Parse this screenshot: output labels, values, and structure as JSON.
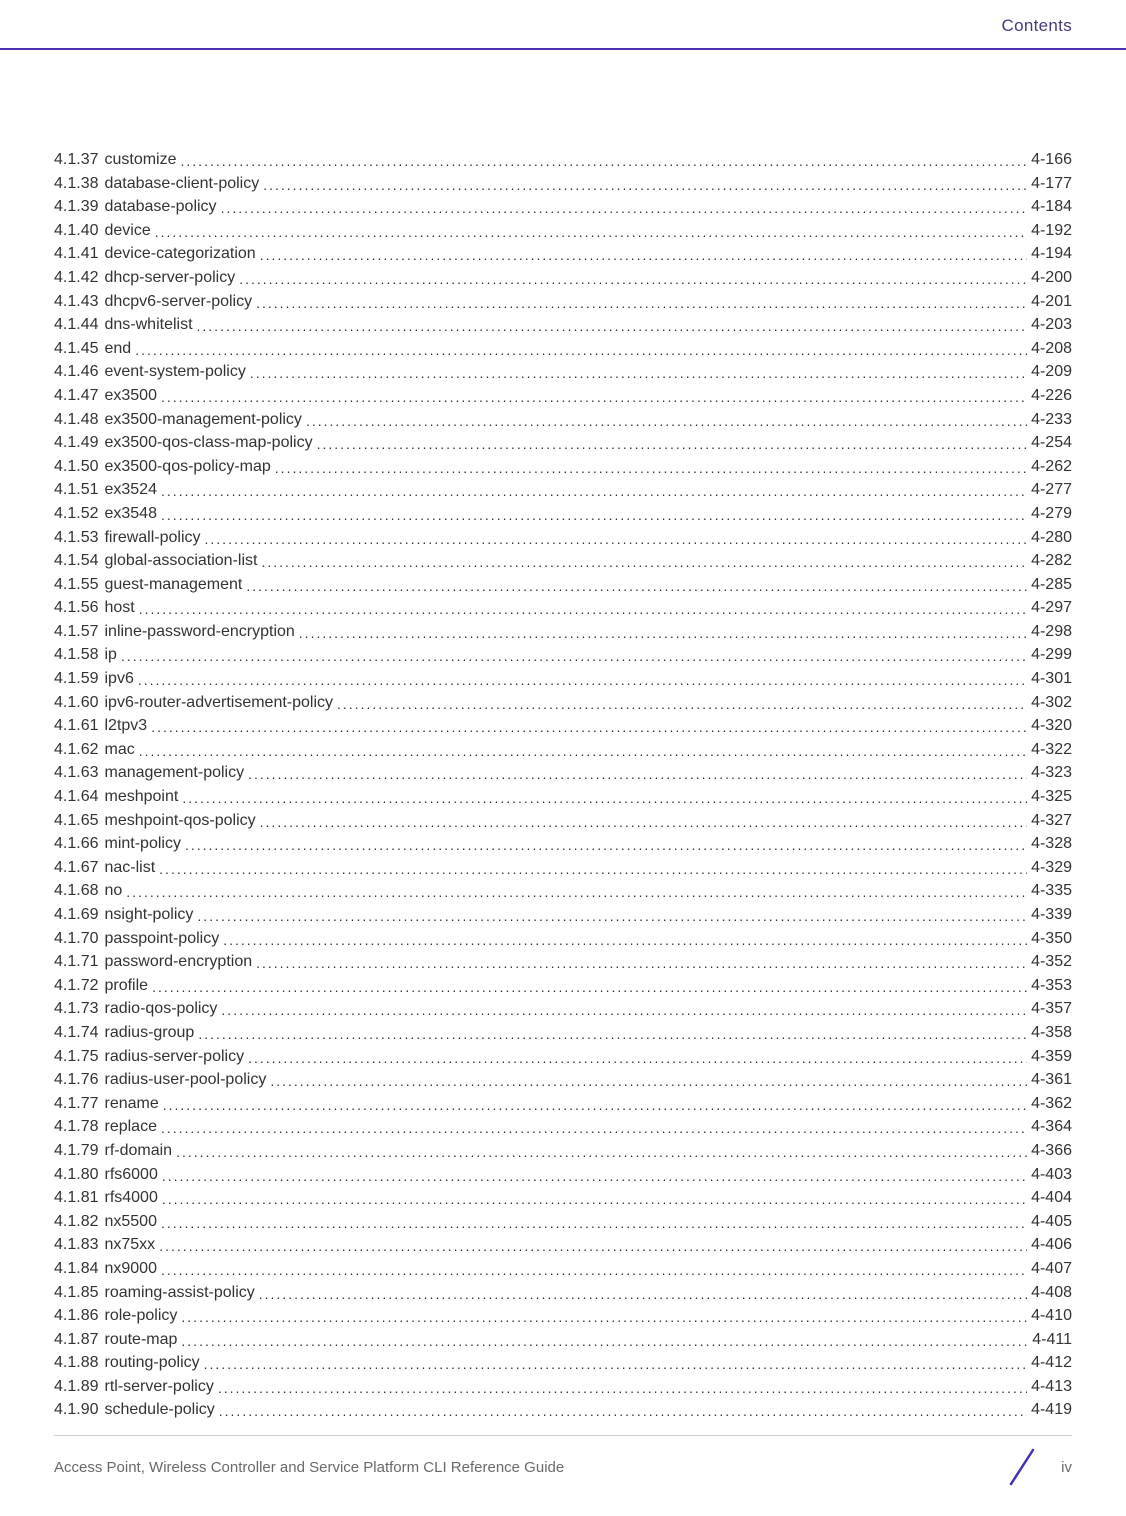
{
  "header": {
    "title": "Contents"
  },
  "toc": {
    "entries": [
      {
        "num": "4.1.37",
        "title": "customize",
        "page": "4-166"
      },
      {
        "num": "4.1.38",
        "title": "database-client-policy",
        "page": "4-177"
      },
      {
        "num": "4.1.39",
        "title": "database-policy",
        "page": "4-184"
      },
      {
        "num": "4.1.40",
        "title": "device",
        "page": "4-192"
      },
      {
        "num": "4.1.41",
        "title": "device-categorization",
        "page": "4-194"
      },
      {
        "num": "4.1.42",
        "title": "dhcp-server-policy",
        "page": "4-200"
      },
      {
        "num": "4.1.43",
        "title": "dhcpv6-server-policy",
        "page": "4-201"
      },
      {
        "num": "4.1.44",
        "title": "dns-whitelist",
        "page": "4-203"
      },
      {
        "num": "4.1.45",
        "title": "end",
        "page": "4-208"
      },
      {
        "num": "4.1.46",
        "title": "event-system-policy",
        "page": "4-209"
      },
      {
        "num": "4.1.47",
        "title": "ex3500",
        "page": "4-226"
      },
      {
        "num": "4.1.48",
        "title": "ex3500-management-policy",
        "page": "4-233"
      },
      {
        "num": "4.1.49",
        "title": "ex3500-qos-class-map-policy",
        "page": "4-254"
      },
      {
        "num": "4.1.50",
        "title": "ex3500-qos-policy-map",
        "page": "4-262"
      },
      {
        "num": "4.1.51",
        "title": "ex3524",
        "page": "4-277"
      },
      {
        "num": "4.1.52",
        "title": "ex3548",
        "page": "4-279"
      },
      {
        "num": "4.1.53",
        "title": "firewall-policy",
        "page": "4-280"
      },
      {
        "num": "4.1.54",
        "title": "global-association-list",
        "page": "4-282"
      },
      {
        "num": "4.1.55",
        "title": "guest-management",
        "page": "4-285"
      },
      {
        "num": "4.1.56",
        "title": "host",
        "page": "4-297"
      },
      {
        "num": "4.1.57",
        "title": "inline-password-encryption",
        "page": "4-298"
      },
      {
        "num": "4.1.58",
        "title": "ip",
        "page": "4-299"
      },
      {
        "num": "4.1.59",
        "title": "ipv6",
        "page": "4-301"
      },
      {
        "num": "4.1.60",
        "title": "ipv6-router-advertisement-policy",
        "page": "4-302"
      },
      {
        "num": "4.1.61",
        "title": "l2tpv3",
        "page": "4-320"
      },
      {
        "num": "4.1.62",
        "title": "mac",
        "page": "4-322"
      },
      {
        "num": "4.1.63",
        "title": "management-policy",
        "page": "4-323"
      },
      {
        "num": "4.1.64",
        "title": "meshpoint",
        "page": "4-325"
      },
      {
        "num": "4.1.65",
        "title": "meshpoint-qos-policy",
        "page": "4-327"
      },
      {
        "num": "4.1.66",
        "title": "mint-policy",
        "page": "4-328"
      },
      {
        "num": "4.1.67",
        "title": "nac-list",
        "page": "4-329"
      },
      {
        "num": "4.1.68",
        "title": "no",
        "page": "4-335"
      },
      {
        "num": "4.1.69",
        "title": "nsight-policy",
        "page": "4-339"
      },
      {
        "num": "4.1.70",
        "title": "passpoint-policy",
        "page": "4-350"
      },
      {
        "num": "4.1.71",
        "title": "password-encryption",
        "page": "4-352"
      },
      {
        "num": "4.1.72",
        "title": "profile",
        "page": "4-353"
      },
      {
        "num": "4.1.73",
        "title": "radio-qos-policy",
        "page": "4-357"
      },
      {
        "num": "4.1.74",
        "title": "radius-group",
        "page": "4-358"
      },
      {
        "num": "4.1.75",
        "title": "radius-server-policy",
        "page": "4-359"
      },
      {
        "num": "4.1.76",
        "title": "radius-user-pool-policy",
        "page": "4-361"
      },
      {
        "num": "4.1.77",
        "title": "rename",
        "page": "4-362"
      },
      {
        "num": "4.1.78",
        "title": "replace",
        "page": "4-364"
      },
      {
        "num": "4.1.79",
        "title": "rf-domain",
        "page": "4-366"
      },
      {
        "num": "4.1.80",
        "title": "rfs6000",
        "page": "4-403"
      },
      {
        "num": "4.1.81",
        "title": "rfs4000",
        "page": "4-404"
      },
      {
        "num": "4.1.82",
        "title": "nx5500",
        "page": "4-405"
      },
      {
        "num": "4.1.83",
        "title": "nx75xx",
        "page": "4-406"
      },
      {
        "num": "4.1.84",
        "title": "nx9000",
        "page": "4-407"
      },
      {
        "num": "4.1.85",
        "title": "roaming-assist-policy",
        "page": "4-408"
      },
      {
        "num": "4.1.86",
        "title": "role-policy",
        "page": "4-410"
      },
      {
        "num": "4.1.87",
        "title": "route-map",
        "page": "4-411"
      },
      {
        "num": "4.1.88",
        "title": "routing-policy",
        "page": "4-412"
      },
      {
        "num": "4.1.89",
        "title": "rtl-server-policy",
        "page": "4-413"
      },
      {
        "num": "4.1.90",
        "title": "schedule-policy",
        "page": "4-419"
      }
    ]
  },
  "footer": {
    "text": "Access Point, Wireless Controller and Service Platform CLI Reference Guide",
    "pagenum": "iv"
  },
  "colors": {
    "accent": "#4a2fb0",
    "header_text": "#4a3a7a"
  }
}
